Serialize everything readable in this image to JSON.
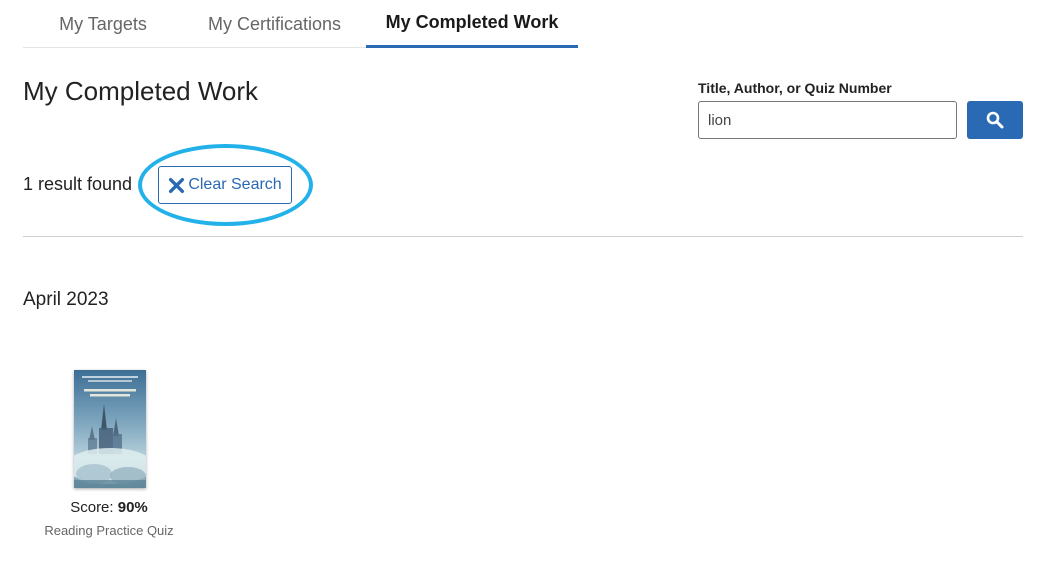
{
  "tabs": [
    {
      "label": "My Targets"
    },
    {
      "label": "My Certifications"
    },
    {
      "label": "My Completed Work"
    }
  ],
  "main": {
    "title": "My Completed Work",
    "result_count": "1 result found",
    "clear_search_label": "Clear Search",
    "month": "April 2023"
  },
  "search": {
    "label": "Title, Author, or Quiz Number",
    "value": "lion"
  },
  "books": [
    {
      "cover_title": "The Lion, the Witch and the Wardrobe",
      "score_label": "Score:",
      "score_value": "90%",
      "quiz_type": "Reading Practice Quiz"
    }
  ],
  "colors": {
    "accent": "#2a69b4",
    "highlight_ring": "#22b1e8"
  }
}
